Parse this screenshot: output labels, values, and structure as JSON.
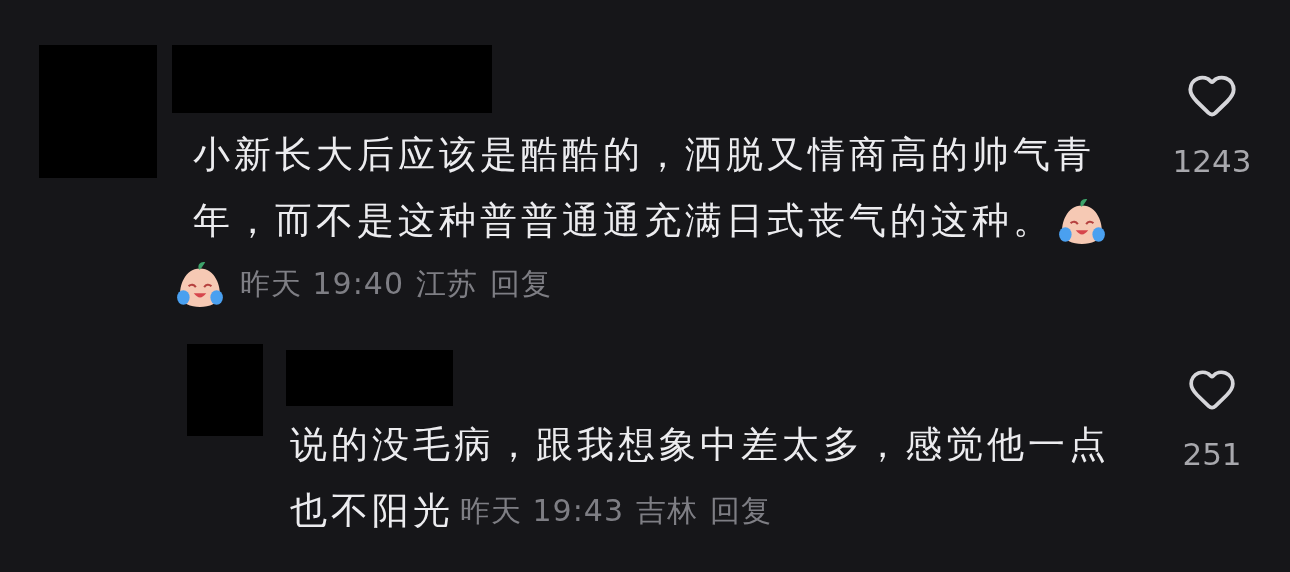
{
  "comments": [
    {
      "body_lines": [
        "小新长大后应该是酷酷的，洒脱又情商高的帅气青",
        "年，而不是这种普普通通充满日式丧气的这种。"
      ],
      "trailing_emoji": true,
      "leading_emoji": true,
      "time": "昨天 19:40",
      "location": "江苏",
      "reply_label": "回复",
      "likes": "1243",
      "children": [
        {
          "body_lines": [
            "说的没毛病，跟我想象中差太多，感觉他一点",
            "也不阳光"
          ],
          "trailing_emoji": false,
          "leading_emoji": false,
          "time": "昨天 19:43",
          "location": "吉林",
          "reply_label": "回复",
          "likes": "251"
        }
      ]
    }
  ]
}
